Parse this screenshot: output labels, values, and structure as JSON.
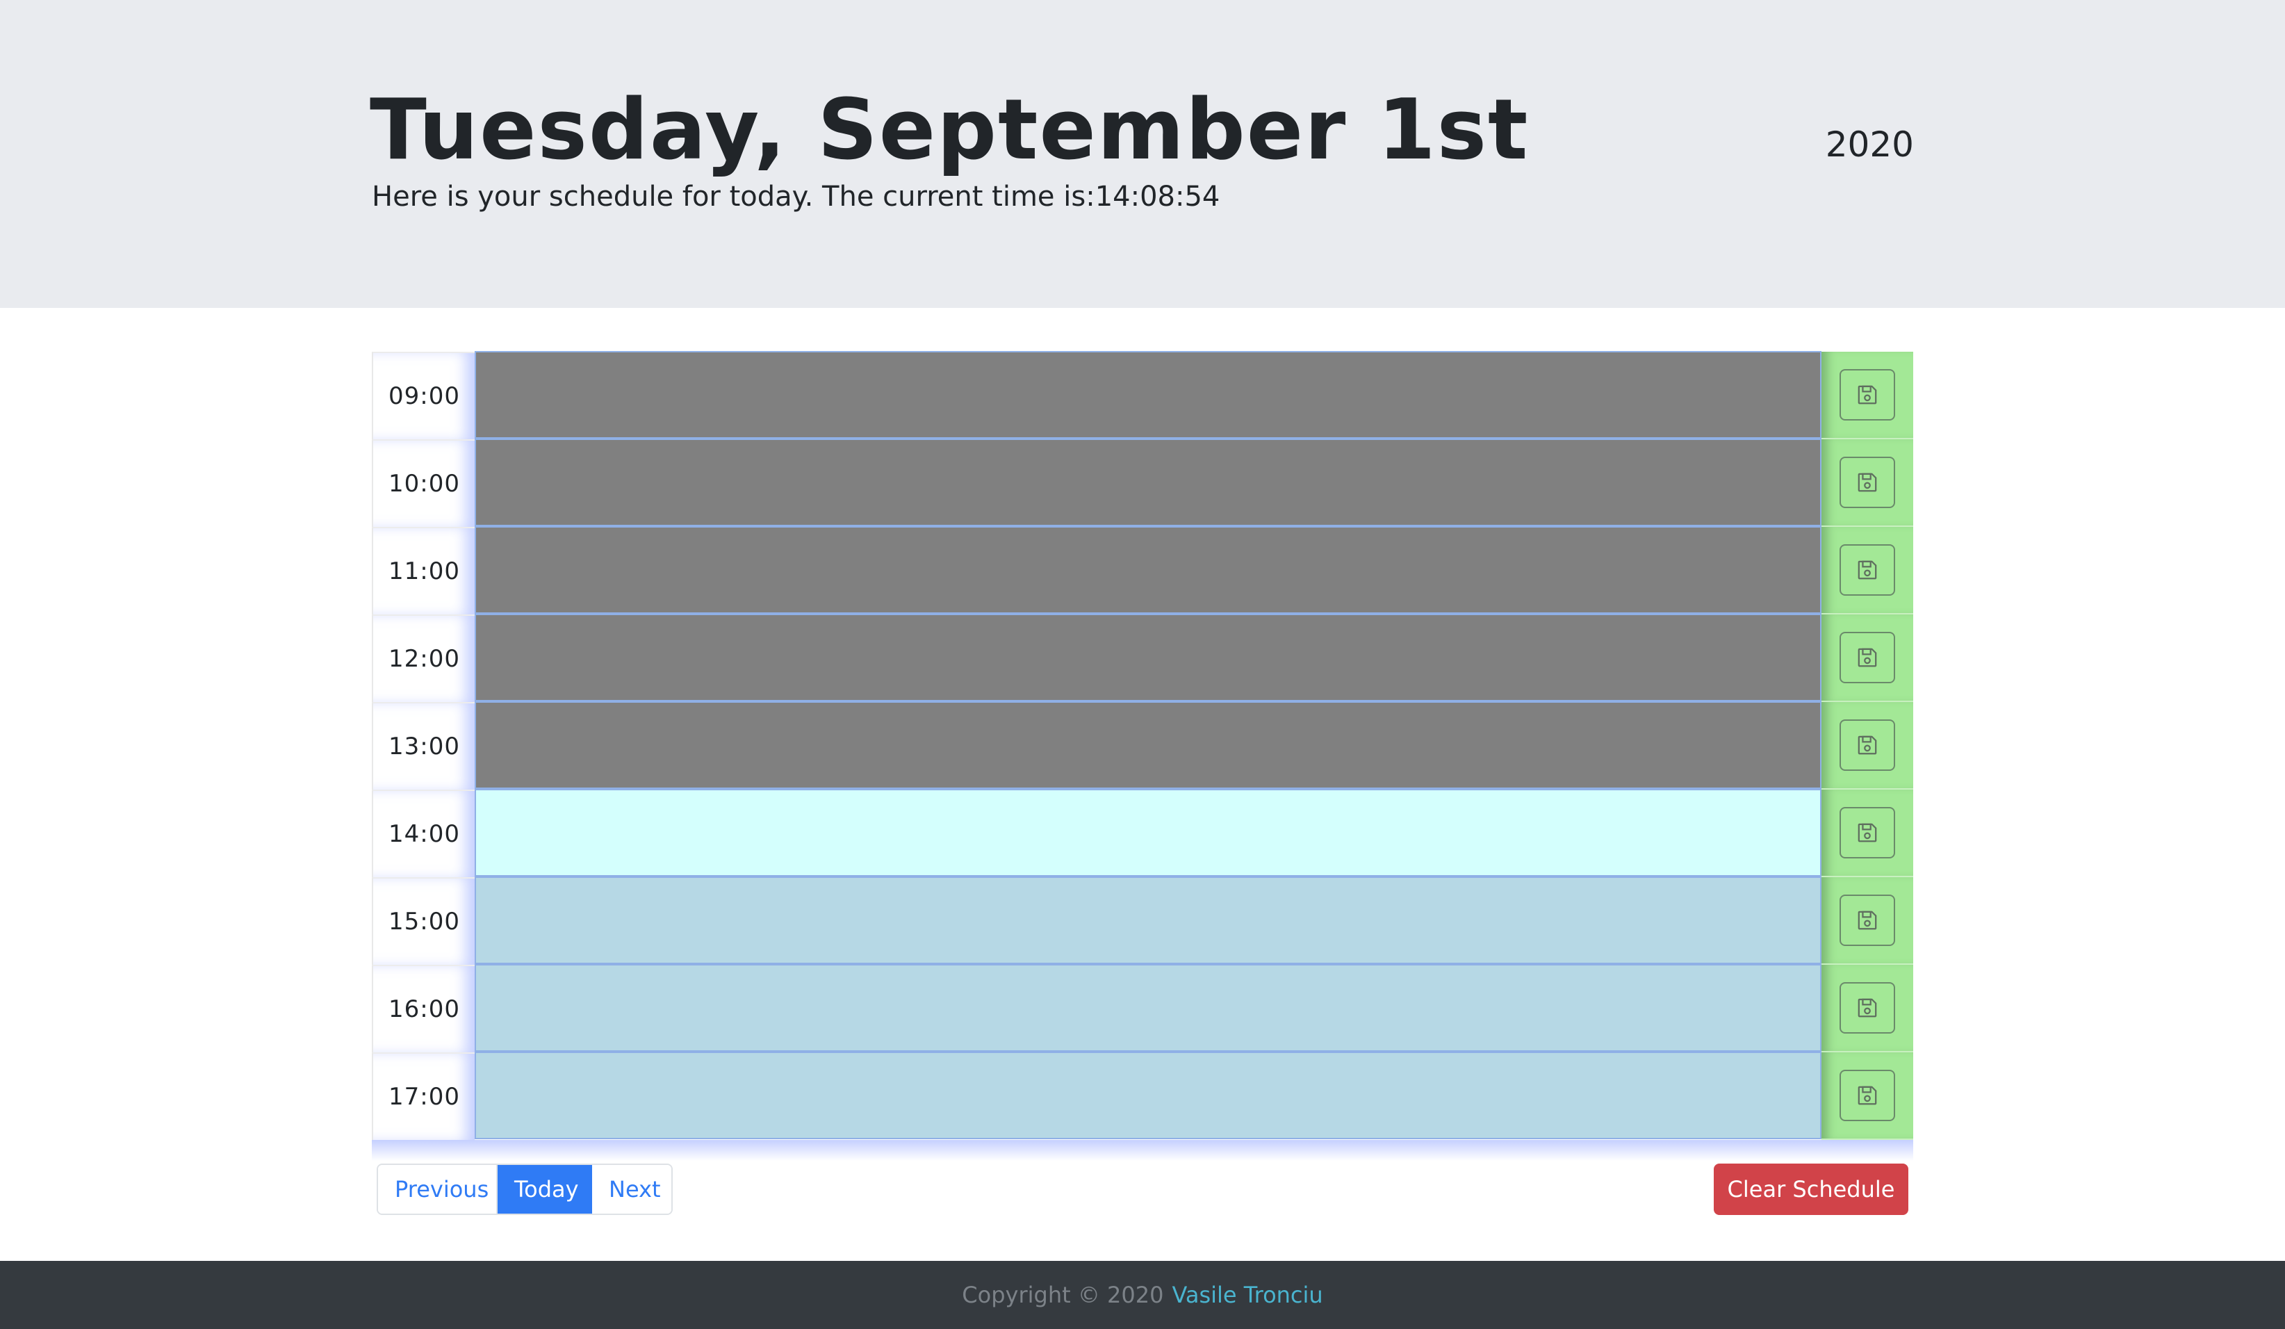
{
  "header": {
    "title": "Tuesday, September 1st",
    "subtitle_prefix": "Here is your schedule for today. The current time is:",
    "current_time": "14:08:54",
    "year": "2020"
  },
  "schedule": {
    "rows": [
      {
        "hour": "09:00",
        "state": "past",
        "text": ""
      },
      {
        "hour": "10:00",
        "state": "past",
        "text": ""
      },
      {
        "hour": "11:00",
        "state": "past",
        "text": ""
      },
      {
        "hour": "12:00",
        "state": "past",
        "text": ""
      },
      {
        "hour": "13:00",
        "state": "past",
        "text": ""
      },
      {
        "hour": "14:00",
        "state": "present",
        "text": ""
      },
      {
        "hour": "15:00",
        "state": "future",
        "text": ""
      },
      {
        "hour": "16:00",
        "state": "future",
        "text": ""
      },
      {
        "hour": "17:00",
        "state": "future",
        "text": ""
      }
    ],
    "save_icon": "floppy-disk-icon"
  },
  "pagination": {
    "previous_label": "Previous",
    "today_label": "Today",
    "next_label": "Next"
  },
  "actions": {
    "clear_label": "Clear Schedule"
  },
  "footer": {
    "copyright_text": "Copyright © 2020",
    "author_link": "Vasile Tronciu"
  },
  "colors": {
    "past": "#808080",
    "present": "#d4fffd",
    "future": "#b6d8e5",
    "save": "#a3e896",
    "primary": "#2f7bf5",
    "danger": "#d14349"
  }
}
